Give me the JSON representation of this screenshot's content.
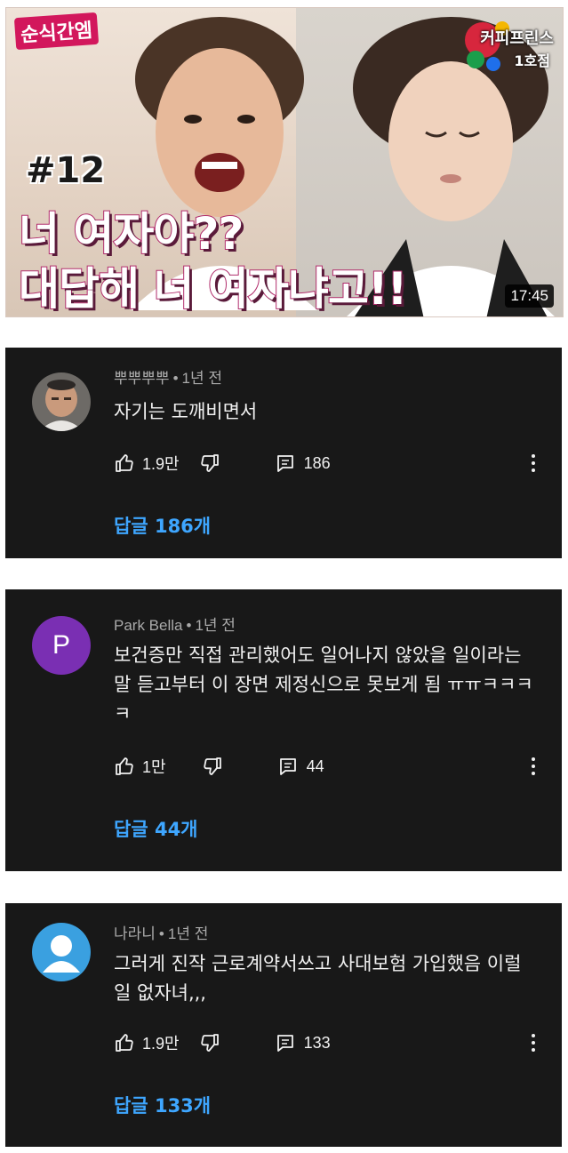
{
  "video": {
    "badge": "순식간엠",
    "logo": "커피프린스",
    "logo_sub": "1호점",
    "episode": "#12",
    "headline_line1": "너 여자야??",
    "headline_line2": "대답해 너 여자냐고!!",
    "duration": "17:45"
  },
  "comments": [
    {
      "author": "뿌뿌뿌뿌",
      "time": "1년 전",
      "text": "자기는 도깨비면서",
      "likes": "1.9만",
      "reply_count": "186",
      "replies_label": "답글 186개",
      "avatar": "photo-avatar"
    },
    {
      "author": "Park Bella",
      "time": "1년 전",
      "text": "보건증만 직접 관리했어도 일어나지 않았을 일이라는 말 듣고부터 이 장면 제정신으로 못보게 됨 ㅠㅠㅋㅋㅋㅋ",
      "likes": "1만",
      "reply_count": "44",
      "replies_label": "답글 44개",
      "avatar_letter": "P",
      "avatar_color": "#7a2fb3"
    },
    {
      "author": "나라니",
      "time": "1년 전",
      "text": "그러게 진작 근로계약서쓰고 사대보험 가입했음 이럴 일 없자녀,,,",
      "likes": "1.9만",
      "reply_count": "133",
      "replies_label": "답글 133개",
      "avatar": "default-person-avatar",
      "avatar_color": "#3aa0e0"
    }
  ],
  "colors": {
    "card_bg": "#181818",
    "link": "#3ea6ff",
    "meta": "#aaaaaa"
  }
}
